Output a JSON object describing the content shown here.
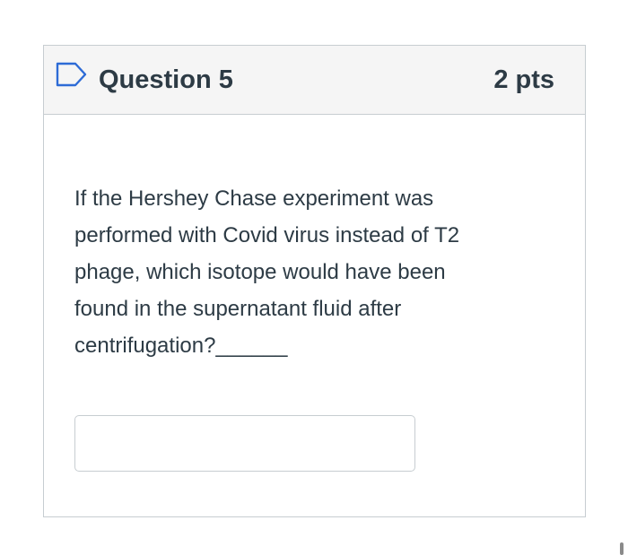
{
  "question": {
    "title": "Question 5",
    "points": "2 pts",
    "flag_icon": "flag-outline-icon",
    "text_lines": [
      "If the Hershey Chase experiment was",
      "performed with Covid virus instead of T2",
      "phage, which isotope would have been",
      "found in the supernatant fluid after",
      "centrifugation?______"
    ],
    "answer": {
      "value": "",
      "placeholder": ""
    }
  },
  "colors": {
    "header_background": "#f5f5f5",
    "border": "#c7cdd1",
    "text": "#2d3b45",
    "flag_accent": "#2d6bd6"
  }
}
